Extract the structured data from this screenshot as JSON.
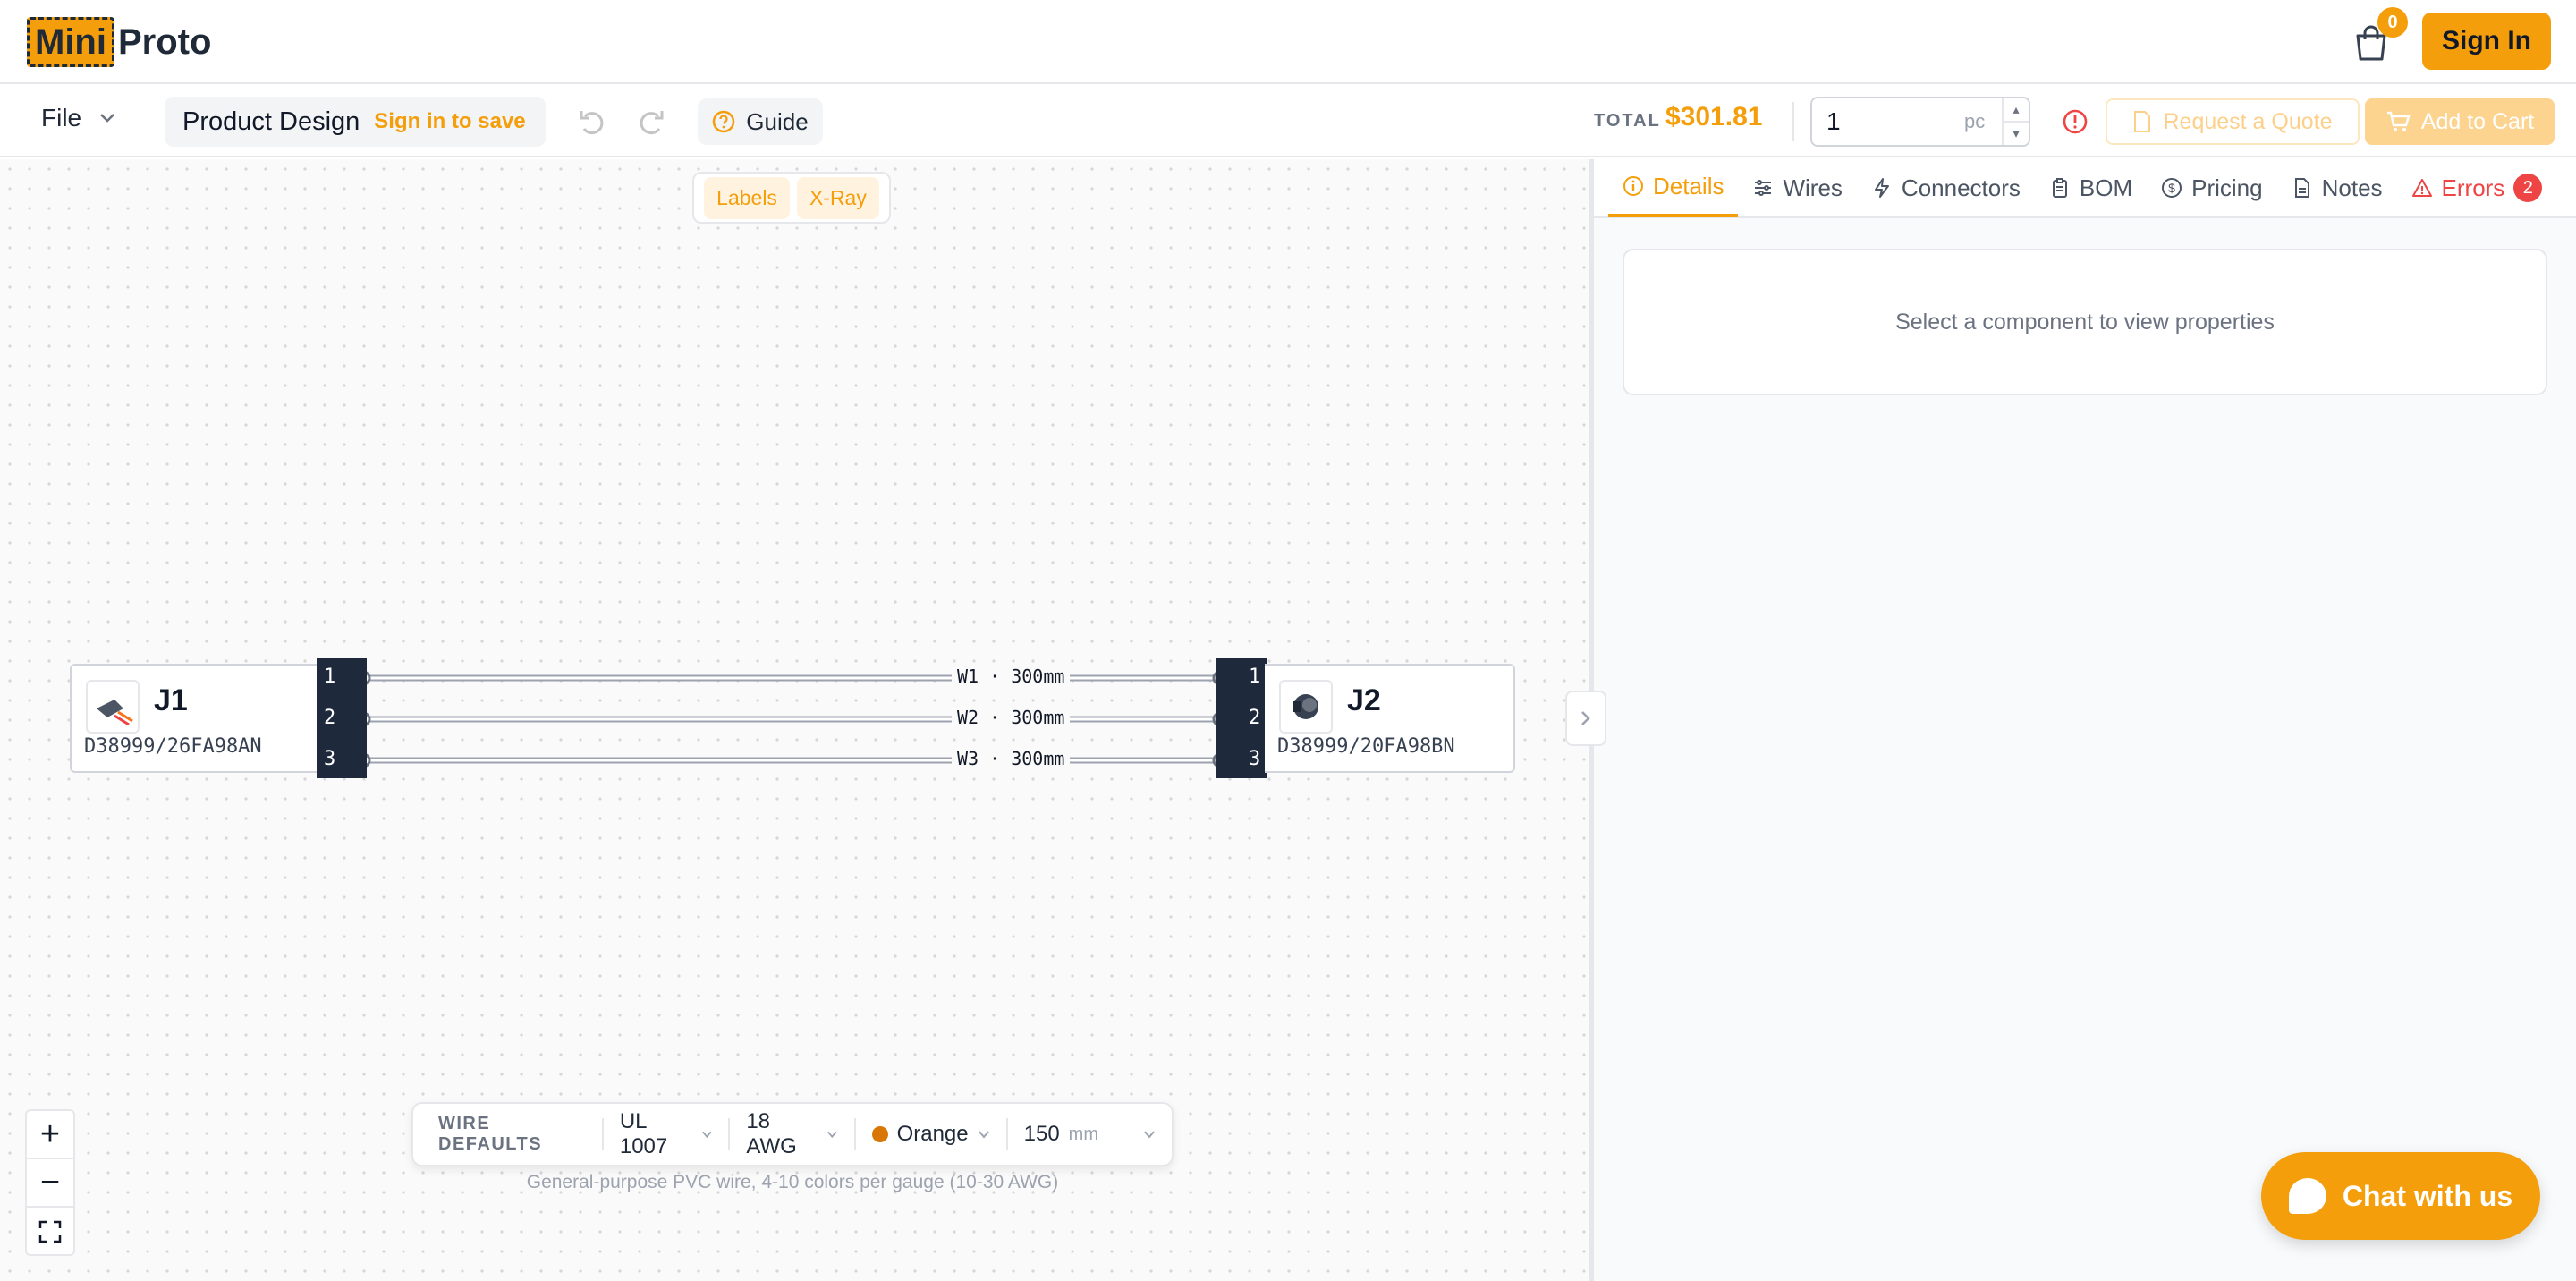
{
  "header": {
    "logo_mini": "Mini",
    "logo_proto": "Proto",
    "cart_count": "0",
    "sign_in": "Sign In"
  },
  "toolbar": {
    "file": "File",
    "project_title": "Product Design",
    "sign_in_to_save": "Sign in to save",
    "guide": "Guide",
    "total_label": "TOTAL",
    "total_value": "$301.81",
    "quantity": "1",
    "quantity_unit": "pc",
    "request_quote": "Request a Quote",
    "add_to_cart": "Add to Cart"
  },
  "canvas": {
    "view_toggles": [
      "Labels",
      "X-Ray"
    ],
    "connectors": [
      {
        "name": "J1",
        "part": "D38999/26FA98AN",
        "pins": [
          "1",
          "2",
          "3"
        ]
      },
      {
        "name": "J2",
        "part": "D38999/20FA98BN",
        "pins": [
          "1",
          "2",
          "3"
        ]
      }
    ],
    "wires": [
      {
        "label": "W1 · 300mm"
      },
      {
        "label": "W2 · 300mm"
      },
      {
        "label": "W3 · 300mm"
      }
    ],
    "wire_defaults": {
      "label": "WIRE DEFAULTS",
      "type": "UL 1007",
      "gauge": "18 AWG",
      "color": "Orange",
      "color_hex": "#d97706",
      "length": "150",
      "length_unit": "mm",
      "description": "General-purpose PVC wire, 4-10 colors per gauge (10-30 AWG)"
    }
  },
  "panel": {
    "tabs": [
      {
        "label": "Details",
        "icon": "info-icon"
      },
      {
        "label": "Wires",
        "icon": "sliders-icon"
      },
      {
        "label": "Connectors",
        "icon": "bolt-icon"
      },
      {
        "label": "BOM",
        "icon": "clipboard-icon"
      },
      {
        "label": "Pricing",
        "icon": "dollar-icon"
      },
      {
        "label": "Notes",
        "icon": "document-icon"
      },
      {
        "label": "Errors",
        "icon": "warning-icon"
      }
    ],
    "error_count": "2",
    "empty_message": "Select a component to view properties"
  },
  "chat": {
    "label": "Chat with us"
  },
  "colors": {
    "accent": "#f59e0b",
    "error": "#ef4444",
    "pin_strip": "#1e293b"
  }
}
